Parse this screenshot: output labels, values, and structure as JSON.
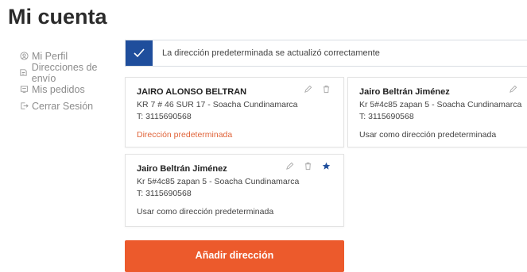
{
  "page": {
    "title": "Mi cuenta"
  },
  "sidebar": {
    "items": [
      {
        "label": "Mi Perfil",
        "icon": "user-icon"
      },
      {
        "label": "Direcciones de envío",
        "icon": "address-icon"
      },
      {
        "label": "Mis pedidos",
        "icon": "orders-icon"
      },
      {
        "label": "Cerrar Sesión",
        "icon": "logout-icon"
      }
    ]
  },
  "alert": {
    "message": "La dirección predeterminada se actualizó correctamente",
    "icon": "check-icon",
    "color": "#1f4e9c"
  },
  "addresses": [
    {
      "name": "JAIRO ALONSO BELTRAN",
      "address": "KR 7 # 46 SUR 17 - Soacha Cundinamarca",
      "phone": "T: 3115690568",
      "status": "Dirección predeterminada"
    },
    {
      "name": "Jairo Beltrán Jiménez",
      "address": "Kr 5#4c85 zapan 5 - Soacha Cundinamarca",
      "phone": "T: 3115690568",
      "status": "Usar como dirección predeterminada"
    },
    {
      "name": "Jairo Beltrán Jiménez",
      "address": "Kr 5#4c85 zapan 5 - Soacha Cundinamarca",
      "phone": "T: 3115690568",
      "status": "Usar como dirección predeterminada"
    }
  ],
  "add_button": {
    "label": "Añadir dirección",
    "color": "#ec5a2c"
  },
  "colors": {
    "accent": "#ec5a2c",
    "primary": "#1f4e9c",
    "default_label": "#e0643a"
  }
}
